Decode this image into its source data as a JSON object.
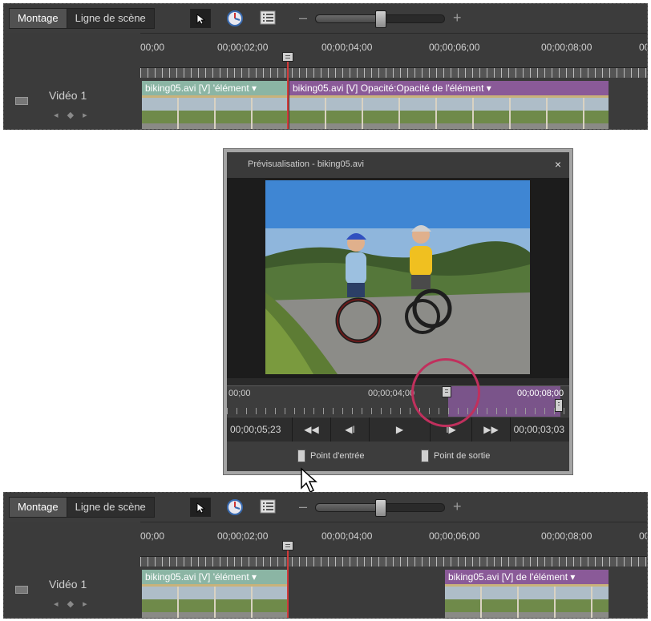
{
  "top_panel": {
    "tabs": [
      "Montage",
      "Ligne de scène"
    ],
    "zoom_minus": "–",
    "zoom_plus": "+",
    "zoom_level": 0.5,
    "ruler": [
      "00;00",
      "00;00;02;00",
      "00;00;04;00",
      "00;00;06;00",
      "00;00;08;00",
      "00"
    ],
    "track": {
      "name": "Vidéo 1",
      "keyframe_nav": "◂ ◆ ▸",
      "clips": [
        "biking05.avi [V] 'élément ▾",
        "biking05.avi [V] Opacité:Opacité de l'élément ▾"
      ]
    }
  },
  "dialog": {
    "title": "Prévisualisation - biking05.avi",
    "close": "×",
    "scrub_times": [
      "00;00",
      "00;00;04;00",
      "00;00;08;00"
    ],
    "current_time": "00;00;05;23",
    "buttons": [
      "◀◀",
      "◀I",
      "▶",
      "I▶",
      "▶▶"
    ],
    "duration": "00;00;03;03",
    "set_in": "Point d'entrée",
    "set_out": "Point de sortie"
  },
  "bottom_panel": {
    "tabs": [
      "Montage",
      "Ligne de scène"
    ],
    "zoom_minus": "–",
    "zoom_plus": "+",
    "zoom_level": 0.5,
    "ruler": [
      "00;00",
      "00;00;02;00",
      "00;00;04;00",
      "00;00;06;00",
      "00;00;08;00",
      "00"
    ],
    "track": {
      "name": "Vidéo 1",
      "keyframe_nav": "◂ ◆ ▸",
      "clips": [
        "biking05.avi [V] 'élément ▾",
        "biking05.avi [V] de l'élément ▾"
      ]
    }
  },
  "colors": {
    "playhead": "#d23b3b",
    "clip_green": "#8bb5a4",
    "clip_purple": "#8a5a98",
    "highlight_circle": "#c0305d"
  }
}
